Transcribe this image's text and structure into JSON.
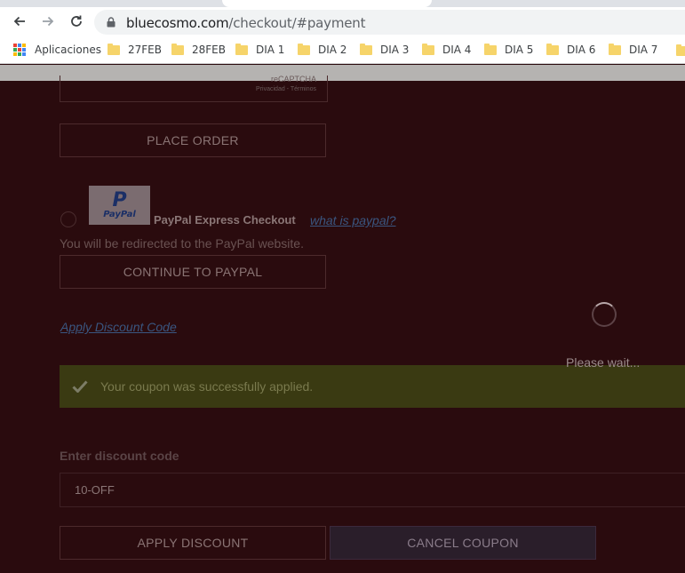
{
  "browser": {
    "url_host": "bluecosmo.com",
    "url_path": "/checkout/#payment",
    "bookmarks": [
      {
        "label": "Aplicaciones",
        "icon": "apps-grid-icon"
      },
      {
        "label": "27FEB",
        "icon": "folder-icon"
      },
      {
        "label": "28FEB",
        "icon": "folder-icon"
      },
      {
        "label": "DIA 1",
        "icon": "folder-icon"
      },
      {
        "label": "DIA 2",
        "icon": "folder-icon"
      },
      {
        "label": "DIA 3",
        "icon": "folder-icon"
      },
      {
        "label": "DIA 4",
        "icon": "folder-icon"
      },
      {
        "label": "DIA 5",
        "icon": "folder-icon"
      },
      {
        "label": "DIA 6",
        "icon": "folder-icon"
      },
      {
        "label": "DIA 7",
        "icon": "folder-icon"
      }
    ]
  },
  "recaptcha": {
    "label": "reCAPTCHA",
    "links": "Privacidad - Términos"
  },
  "checkout": {
    "place_order": "PLACE ORDER",
    "paypal_title": "PayPal Express Checkout",
    "paypal_link": "what is paypal?",
    "paypal_note": "You will be redirected to the PayPal website.",
    "paypal_logo_text": "PayPal",
    "continue_paypal": "CONTINUE TO PAYPAL",
    "apply_discount_link": "Apply Discount Code"
  },
  "loader": {
    "text": "Please wait..."
  },
  "message": {
    "success": "Your coupon was successfully applied."
  },
  "discount": {
    "label": "Enter discount code",
    "value": "10-OFF",
    "apply_button": "APPLY DISCOUNT",
    "cancel_button": "CANCEL COUPON"
  },
  "colors": {
    "overlay_bg": "#2a0b0e",
    "success_bg": "#3a3a12",
    "link": "#3a5680"
  }
}
